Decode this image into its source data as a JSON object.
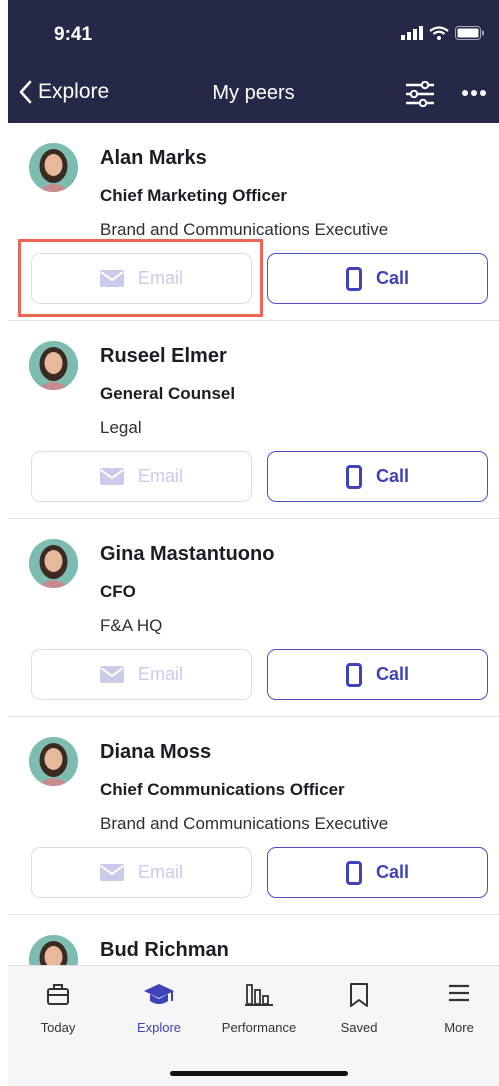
{
  "status_bar": {
    "time": "9:41"
  },
  "nav": {
    "back_label": "Explore",
    "title": "My peers"
  },
  "peers": [
    {
      "name": "Alan Marks",
      "title": "Chief Marketing Officer",
      "department": "Brand and Communications Executive",
      "email_label": "Email",
      "call_label": "Call"
    },
    {
      "name": "Ruseel Elmer",
      "title": "General Counsel",
      "department": "Legal",
      "email_label": "Email",
      "call_label": "Call"
    },
    {
      "name": "Gina Mastantuono",
      "title": "CFO",
      "department": "F&A HQ",
      "email_label": "Email",
      "call_label": "Call"
    },
    {
      "name": "Diana Moss",
      "title": "Chief Communications Officer",
      "department": "Brand and Communications Executive",
      "email_label": "Email",
      "call_label": "Call"
    },
    {
      "name": "Bud Richman",
      "title": "",
      "department": "",
      "email_label": "",
      "call_label": ""
    }
  ],
  "tabbar": {
    "tabs": [
      {
        "label": "Today",
        "icon": "briefcase-icon",
        "active": false
      },
      {
        "label": "Explore",
        "icon": "graduation-cap-icon",
        "active": true
      },
      {
        "label": "Performance",
        "icon": "bar-chart-icon",
        "active": false
      },
      {
        "label": "Saved",
        "icon": "bookmark-icon",
        "active": false
      },
      {
        "label": "More",
        "icon": "menu-icon",
        "active": false
      }
    ]
  },
  "colors": {
    "header_bg": "#262848",
    "accent": "#3f42b8",
    "email_disabled": "#c9cbe9",
    "highlight": "#ee6656"
  }
}
